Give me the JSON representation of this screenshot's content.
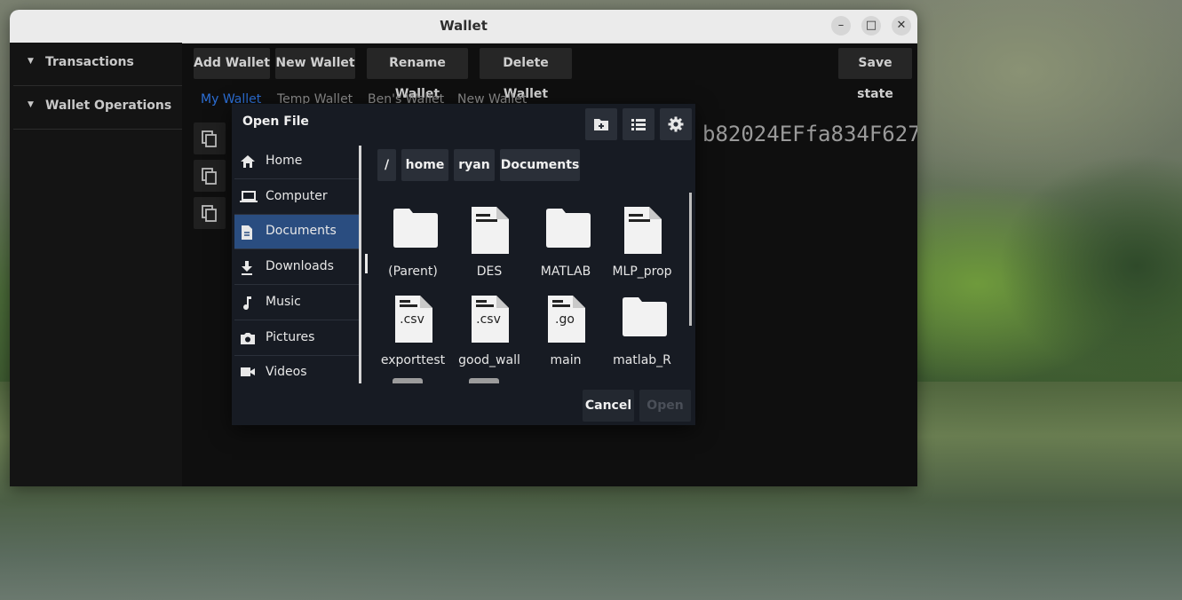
{
  "window": {
    "title": "Wallet"
  },
  "window_controls": [
    "minimize",
    "maximize",
    "close"
  ],
  "sidebar": {
    "items": [
      {
        "label": "Transactions"
      },
      {
        "label": "Wallet Operations"
      }
    ]
  },
  "toolbar": {
    "add_wallet": "Add Wallet",
    "new_wallet": "New Wallet",
    "rename_wallet": "Rename Wallet",
    "delete_wallet": "Delete Wallet",
    "save_state": "Save state"
  },
  "tabs": [
    {
      "label": "My Wallet",
      "active": true
    },
    {
      "label": "Temp Wallet"
    },
    {
      "label": "Ben's Wallet"
    },
    {
      "label": "New Wallet"
    }
  ],
  "address_text": "b82024EFfa834F627",
  "dialog": {
    "title": "Open File",
    "header_icons": [
      "new-folder-icon",
      "list-view-icon",
      "settings-icon"
    ],
    "places": [
      {
        "label": "Home",
        "icon": "home-icon"
      },
      {
        "label": "Computer",
        "icon": "laptop-icon"
      },
      {
        "label": "Documents",
        "icon": "document-icon",
        "selected": true
      },
      {
        "label": "Downloads",
        "icon": "download-icon"
      },
      {
        "label": "Music",
        "icon": "music-icon"
      },
      {
        "label": "Pictures",
        "icon": "camera-icon"
      },
      {
        "label": "Videos",
        "icon": "video-icon"
      }
    ],
    "breadcrumb": [
      "/",
      "home",
      "ryan",
      "Documents"
    ],
    "files": [
      {
        "name": "(Parent)",
        "type": "folder"
      },
      {
        "name": "DES",
        "type": "file"
      },
      {
        "name": "MATLAB",
        "type": "folder"
      },
      {
        "name": "MLP_prop",
        "type": "file"
      },
      {
        "name": "exporttest",
        "type": "file",
        "ext": ".csv"
      },
      {
        "name": "good_wall",
        "type": "file",
        "ext": ".csv"
      },
      {
        "name": "main",
        "type": "file",
        "ext": ".go"
      },
      {
        "name": "matlab_R",
        "type": "folder"
      }
    ],
    "cancel": "Cancel",
    "open": "Open"
  },
  "colors": {
    "accent": "#2c6fd6",
    "selected_place": "#2a4d80",
    "dialog_bg": "#171b23",
    "window_bg": "#0f0f0f"
  }
}
